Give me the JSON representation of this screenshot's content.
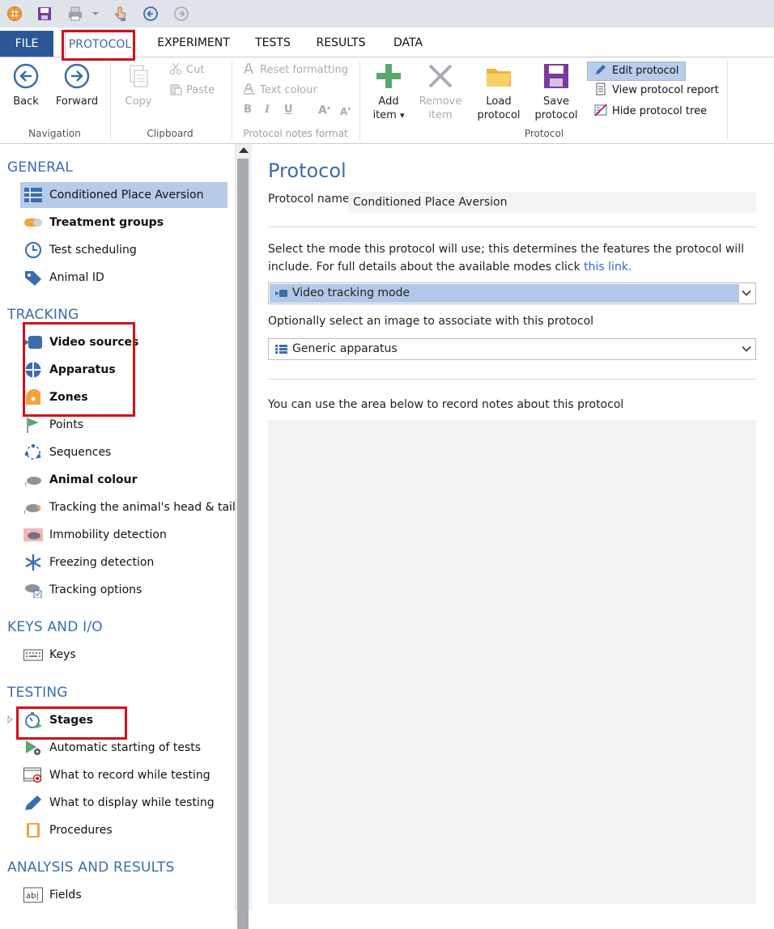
{
  "ribbon": {
    "tabs": [
      "FILE",
      "PROTOCOL",
      "EXPERIMENT",
      "TESTS",
      "RESULTS",
      "DATA"
    ],
    "navigation": {
      "back": "Back",
      "forward": "Forward",
      "label": "Navigation"
    },
    "clipboard": {
      "copy": "Copy",
      "cut": "Cut",
      "paste": "Paste",
      "label": "Clipboard"
    },
    "format": {
      "reset": "Reset formatting",
      "text_colour": "Text colour",
      "bold": "B",
      "italic": "I",
      "underline": "U",
      "grow": "A",
      "shrink": "A",
      "label": "Protocol notes format"
    },
    "protocol": {
      "add_item_1": "Add",
      "add_item_2": "item",
      "add_item_arrow": "▾",
      "remove_item_1": "Remove",
      "remove_item_2": "item",
      "load_1": "Load",
      "load_2": "protocol",
      "save_1": "Save",
      "save_2": "protocol",
      "edit": "Edit protocol",
      "view_report": "View protocol report",
      "hide_tree": "Hide protocol tree",
      "label": "Protocol"
    }
  },
  "sidebar": {
    "general": {
      "title": "GENERAL",
      "items": [
        "Conditioned Place Aversion",
        "Treatment groups",
        "Test scheduling",
        "Animal ID"
      ]
    },
    "tracking": {
      "title": "TRACKING",
      "items": [
        "Video sources",
        "Apparatus",
        "Zones",
        "Points",
        "Sequences",
        "Animal colour",
        "Tracking the animal's head & tail",
        "Immobility detection",
        "Freezing detection",
        "Tracking options"
      ]
    },
    "keys_io": {
      "title": "KEYS AND I/O",
      "items": [
        "Keys"
      ]
    },
    "testing": {
      "title": "TESTING",
      "items": [
        "Stages",
        "Automatic starting of tests",
        "What to record while testing",
        "What to display while testing",
        "Procedures"
      ]
    },
    "analysis": {
      "title": "ANALYSIS AND RESULTS",
      "items": [
        "Fields"
      ]
    }
  },
  "main": {
    "title": "Protocol",
    "name_label": "Protocol name",
    "name_value": "Conditioned Place Aversion",
    "mode_text_1": "Select the mode this protocol will use; this determines the features the protocol will",
    "mode_text_2": "include. For full details about the available modes click ",
    "mode_link": "this link.",
    "mode_value": "Video tracking mode",
    "image_text": "Optionally select an image to associate with this protocol",
    "image_value": "Generic apparatus",
    "notes_text": "You can use the area below to record notes about this protocol"
  },
  "colors": {
    "accent": "#3b6cab",
    "file_tab": "#2b5797",
    "selection": "#b6cbe9",
    "highlight": "#d0121b"
  }
}
